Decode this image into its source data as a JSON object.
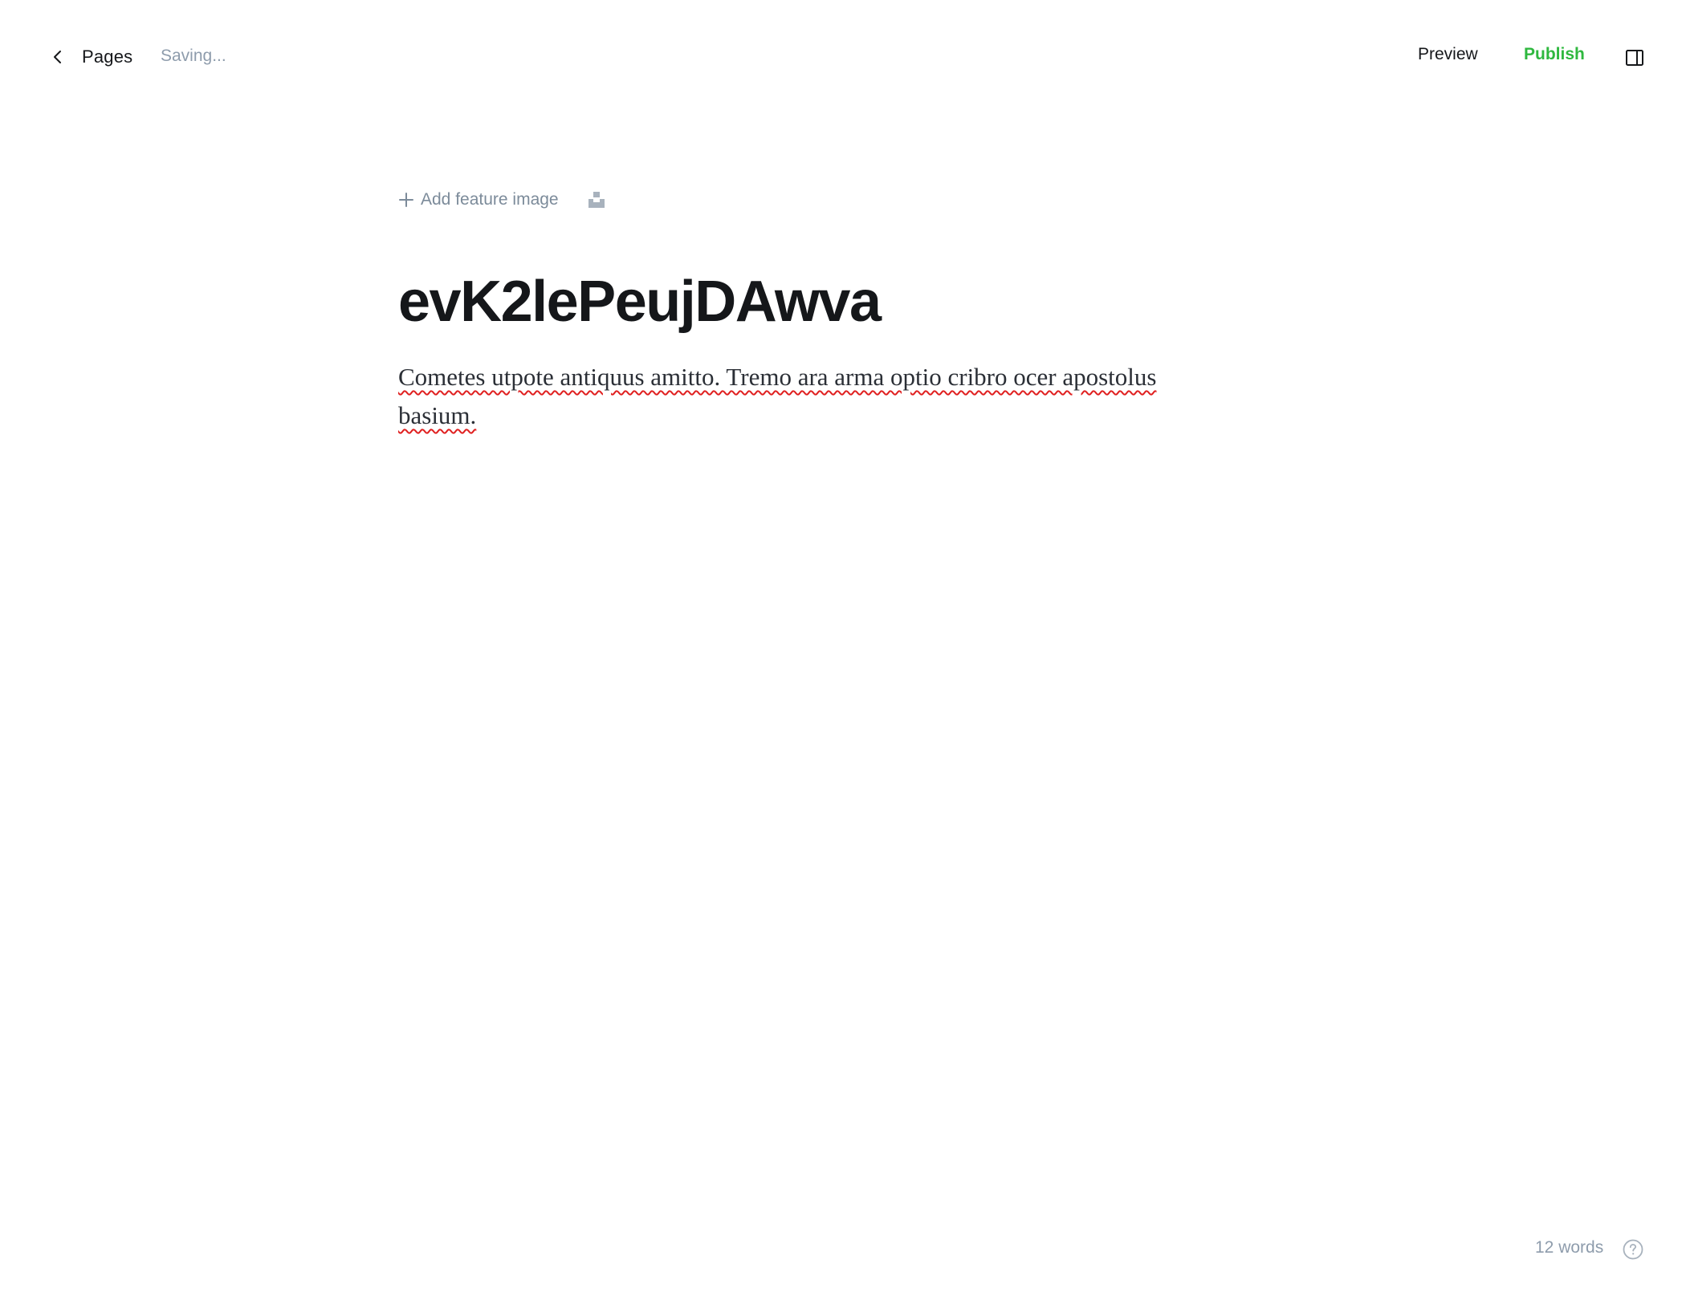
{
  "header": {
    "back_label": "Pages",
    "status": "Saving...",
    "preview_label": "Preview",
    "publish_label": "Publish"
  },
  "editor": {
    "add_feature_image_label": "Add feature image",
    "title": "evK2lePeujDAwva",
    "body": "Cometes utpote antiquus amitto. Tremo ara arma optio cribro ocer apostolus basium."
  },
  "footer": {
    "word_count": "12 words"
  },
  "colors": {
    "publish": "#2fb83f",
    "muted": "#8e9cac",
    "text": "#15171a",
    "spellcheck": "#e02020"
  },
  "icons": {
    "back": "chevron-left-icon",
    "sidebar": "sidebar-toggle-icon",
    "add": "plus-icon",
    "unsplash": "unsplash-icon",
    "help": "help-circle-icon"
  }
}
